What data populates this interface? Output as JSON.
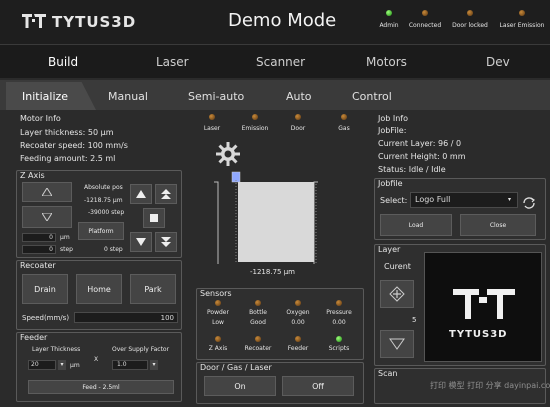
{
  "header": {
    "brand": "TYTUS3D",
    "mode_title": "Demo Mode",
    "status_indicators": [
      {
        "label": "Admin",
        "state": "on"
      },
      {
        "label": "Connected",
        "state": "off"
      },
      {
        "label": "Door locked",
        "state": "off"
      },
      {
        "label": "Laser Emission",
        "state": "off"
      }
    ]
  },
  "nav": {
    "tabs": [
      "Build",
      "Laser",
      "Scanner",
      "Motors",
      "Dev"
    ],
    "active": "Build"
  },
  "subnav": {
    "tabs": [
      "Initialize",
      "Manual",
      "Semi-auto",
      "Auto",
      "Control"
    ],
    "active": "Initialize"
  },
  "motor_info": {
    "title": "Motor Info",
    "layer_thickness": "Layer thickness:  50 µm",
    "recoater_speed": "Recoater speed:  100 mm/s",
    "feeding_amount": "Feeding amount:  2.5 ml"
  },
  "z_axis": {
    "title": "Z Axis",
    "absolute_pos_label": "Absolute pos",
    "pos_um": "-1218.75  µm",
    "pos_step": "-39000  step",
    "platform_label": "Platform",
    "input1_value": "0",
    "input1_unit": "µm",
    "input2_value": "0",
    "input2_unit": "step",
    "right_value": "0",
    "right_unit": "step"
  },
  "recoater": {
    "title": "Recoater",
    "drain": "Drain",
    "home": "Home",
    "park": "Park",
    "speed_label": "Speed(mm/s)",
    "speed_value": "100"
  },
  "feeder": {
    "title": "Feeder",
    "layer_thickness_label": "Layer Thickness",
    "x_label": "X",
    "oversupply_label": "Over Supply Factor",
    "thickness_value": "20",
    "thickness_unit": "µm",
    "factor_value": "1.0",
    "feed_button": "Feed - 2.5ml"
  },
  "center": {
    "leds": [
      "Laser",
      "Emission",
      "Door",
      "Gas"
    ],
    "position_readout": "-1218.75 µm"
  },
  "sensors": {
    "title": "Sensors",
    "row1": [
      {
        "label": "Powder",
        "value": "Low"
      },
      {
        "label": "Bottle",
        "value": "Good"
      },
      {
        "label": "Oxygen",
        "value": "0.00"
      },
      {
        "label": "Pressure",
        "value": "0.00"
      }
    ],
    "row2": [
      {
        "label": "Z Axis",
        "state": "off"
      },
      {
        "label": "Recoater",
        "state": "off"
      },
      {
        "label": "Feeder",
        "state": "off"
      },
      {
        "label": "Scripts",
        "state": "on"
      }
    ]
  },
  "door_gas_laser": {
    "title": "Door / Gas / Laser",
    "on": "On",
    "off": "Off"
  },
  "job_info": {
    "title": "Job Info",
    "jobfile": "JobFile:",
    "current_layer": "Current Layer:  96  /  0",
    "current_height": "Current Height:  0 mm",
    "status": "Status:  Idle / Idle"
  },
  "jobfile": {
    "title": "Jobfile",
    "select_label": "Select:",
    "selected": "Logo Full",
    "load": "Load",
    "close": "Close"
  },
  "layer": {
    "title": "Layer",
    "current_label": "Curent",
    "value": "5",
    "preview_text": "TYTUS3D"
  },
  "scan": {
    "title": "Scan"
  },
  "watermark": "打印 模型 打印 分享 dayinpai.com"
}
